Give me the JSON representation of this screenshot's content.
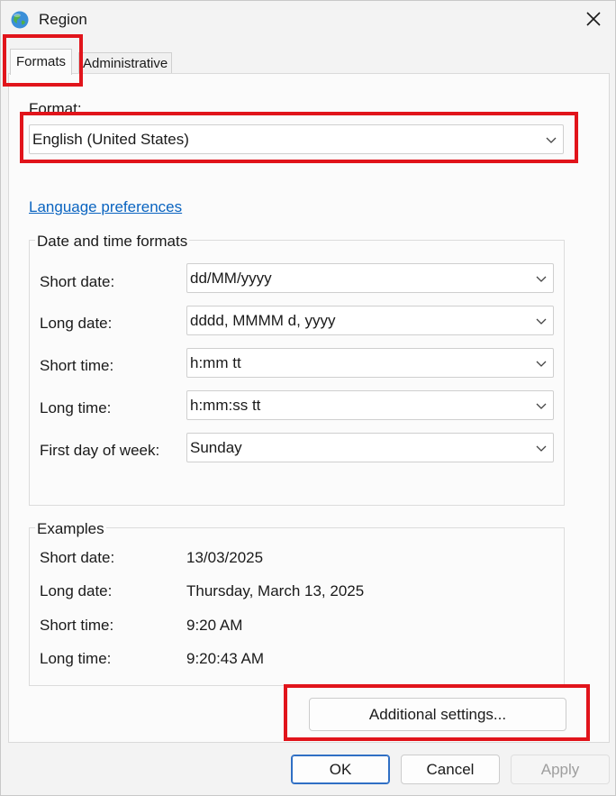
{
  "window": {
    "title": "Region",
    "title_icon": "globe-icon",
    "close_icon": "close-icon"
  },
  "tabs": [
    {
      "label": "Formats",
      "active": true
    },
    {
      "label": "Administrative",
      "active": false
    }
  ],
  "format": {
    "label": "Format:",
    "value": "English (United States)"
  },
  "language_link": "Language preferences",
  "date_time_formats": {
    "title": "Date and time formats",
    "rows": [
      {
        "label": "Short date:",
        "value": "dd/MM/yyyy"
      },
      {
        "label": "Long date:",
        "value": "dddd, MMMM d, yyyy"
      },
      {
        "label": "Short time:",
        "value": "h:mm tt"
      },
      {
        "label": "Long time:",
        "value": "h:mm:ss tt"
      },
      {
        "label": "First day of week:",
        "value": "Sunday"
      }
    ]
  },
  "examples": {
    "title": "Examples",
    "rows": [
      {
        "label": "Short date:",
        "value": "13/03/2025"
      },
      {
        "label": "Long date:",
        "value": "Thursday, March 13, 2025"
      },
      {
        "label": "Short time:",
        "value": "9:20 AM"
      },
      {
        "label": "Long time:",
        "value": "9:20:43 AM"
      }
    ]
  },
  "buttons": {
    "additional_settings": "Additional settings...",
    "ok": "OK",
    "cancel": "Cancel",
    "apply": "Apply"
  },
  "colors": {
    "highlight": "#e1141b",
    "link": "#0a64c0",
    "default_button_border": "#2f6fc4"
  }
}
